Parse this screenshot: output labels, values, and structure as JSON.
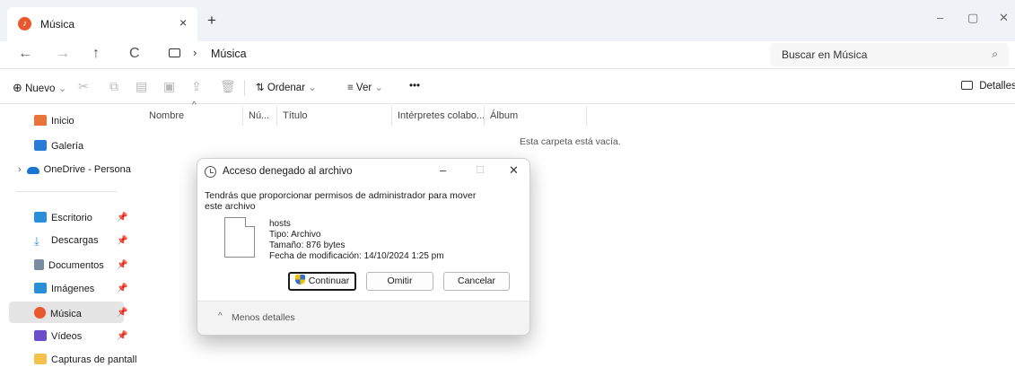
{
  "tab": {
    "title": "Música",
    "close": "×",
    "new_tab": "+"
  },
  "window_controls": {
    "minimize": "–",
    "maximize": "▢",
    "close": "✕"
  },
  "nav": {
    "back": "←",
    "forward": "→",
    "up": "↑",
    "refresh": "C"
  },
  "address": {
    "separator": "›",
    "crumb": "Música"
  },
  "search": {
    "placeholder": "Buscar en Música",
    "icon": "⌕"
  },
  "toolbar": {
    "new_label": "Nuevo",
    "sort_label": "Ordenar",
    "view_label": "Ver",
    "more_label": "•••",
    "details_label": "Detalles"
  },
  "sidebar": {
    "items": [
      {
        "label": "Inicio",
        "icon": "home-icon",
        "color": "#e8743b"
      },
      {
        "label": "Galería",
        "icon": "gallery-icon",
        "color": "#2a7bd6"
      },
      {
        "label": "OneDrive - Persona",
        "icon": "cloud-icon",
        "color": "#1b74d1"
      },
      {
        "label": "Escritorio",
        "icon": "desktop-icon",
        "color": "#2b8fd8"
      },
      {
        "label": "Descargas",
        "icon": "download-icon",
        "color": "#2b8fd8"
      },
      {
        "label": "Documentos",
        "icon": "documents-icon",
        "color": "#7a8aa0"
      },
      {
        "label": "Imágenes",
        "icon": "images-icon",
        "color": "#2b8fd8"
      },
      {
        "label": "Música",
        "icon": "music-icon",
        "color": "#e8582c"
      },
      {
        "label": "Vídeos",
        "icon": "videos-icon",
        "color": "#6a4fc9"
      },
      {
        "label": "Capturas de pantall",
        "icon": "folder-icon",
        "color": "#f2c14e"
      }
    ]
  },
  "columns": [
    "Nombre",
    "Nú...",
    "Título",
    "Intérpretes colabo...",
    "Álbum"
  ],
  "empty_message": "Esta carpeta está vacía.",
  "dialog": {
    "title": "Acceso denegado al archivo",
    "message": "Tendrás que proporcionar permisos de administrador para mover este archivo",
    "file": {
      "name": "hosts",
      "type": "Tipo: Archivo",
      "size": "Tamaño: 876 bytes",
      "modified": "Fecha de modificación: 14/10/2024 1:25 pm"
    },
    "buttons": {
      "continue": "Continuar",
      "skip": "Omitir",
      "cancel": "Cancelar"
    },
    "footer": {
      "chevron": "^",
      "label": "Menos detalles"
    }
  }
}
